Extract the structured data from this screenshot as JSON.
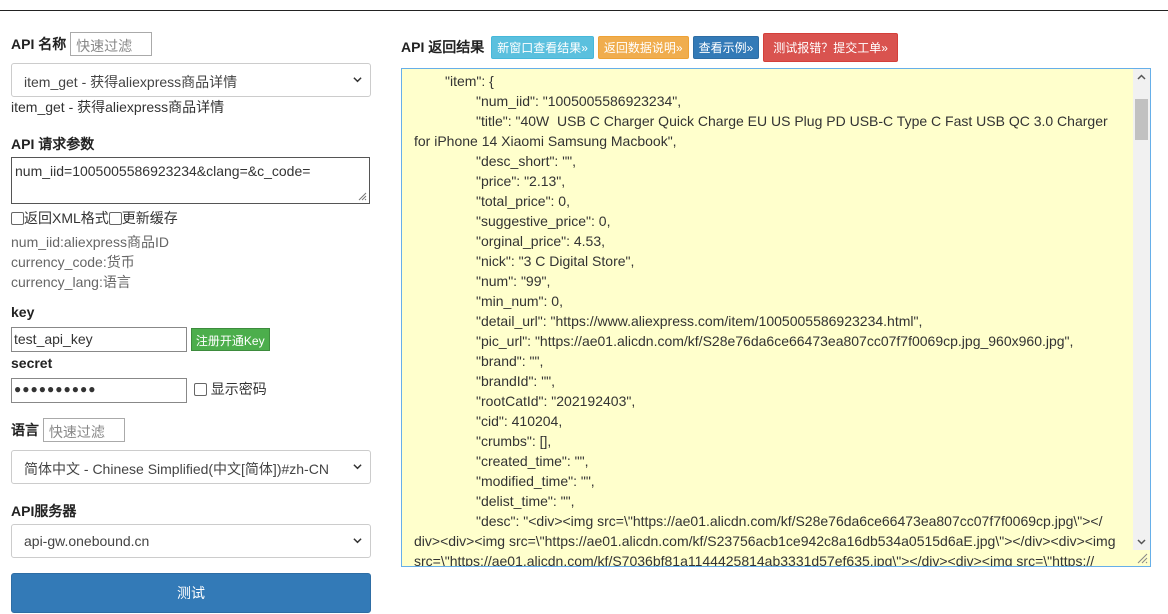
{
  "api_name": {
    "label": "API 名称",
    "filter_placeholder": "快速过滤",
    "selected": "item_get - 获得aliexpress商品详情",
    "caption": "item_get - 获得aliexpress商品详情"
  },
  "params": {
    "label": "API 请求参数",
    "value": "num_iid=1005005586923234&clang=&c_code=",
    "return_xml": "返回XML格式",
    "refresh_cache": "更新缓存",
    "notes": [
      "num_iid:aliexpress商品ID",
      "currency_code:货币",
      "currency_lang:语言"
    ]
  },
  "key": {
    "label": "key",
    "value": "test_api_key",
    "register_button": "注册开通Key"
  },
  "secret": {
    "label": "secret",
    "value": "●●●●●●●●●●",
    "show_password": "显示密码"
  },
  "language": {
    "label": "语言",
    "filter_placeholder": "快速过滤",
    "selected": "简体中文 - Chinese Simplified(中文[简体])#zh-CN"
  },
  "server": {
    "label": "API服务器",
    "selected": "api-gw.onebound.cn"
  },
  "test_button": "测试",
  "result": {
    "title": "API 返回结果",
    "buttons": {
      "new_window": "新窗口查看结果»",
      "return_doc": "返回数据说明»",
      "view_example": "查看示例»",
      "report_bug": "测试报错？提交工单»"
    },
    "lines": [
      "\"item\": {",
      "\"num_iid\": \"1005005586923234\",",
      "\"title\": \"40W  USB C Charger Quick Charge EU US Plug PD USB-C Type C Fast USB QC 3.0 Charger",
      "for iPhone 14 Xiaomi Samsung Macbook\",",
      "\"desc_short\": \"\",",
      "\"price\": \"2.13\",",
      "\"total_price\": 0,",
      "\"suggestive_price\": 0,",
      "\"orginal_price\": 4.53,",
      "\"nick\": \"3 C Digital Store\",",
      "\"num\": \"99\",",
      "\"min_num\": 0,",
      "\"detail_url\": \"https://www.aliexpress.com/item/1005005586923234.html\",",
      "\"pic_url\": \"https://ae01.alicdn.com/kf/S28e76da6ce66473ea807cc07f7f0069cp.jpg_960x960.jpg\",",
      "\"brand\": \"\",",
      "\"brandId\": \"\",",
      "\"rootCatId\": \"202192403\",",
      "\"cid\": 410204,",
      "\"crumbs\": [],",
      "\"created_time\": \"\",",
      "\"modified_time\": \"\",",
      "\"delist_time\": \"\",",
      "\"desc\": \"<div><img src=\\\"https://ae01.alicdn.com/kf/S28e76da6ce66473ea807cc07f7f0069cp.jpg\\\"></",
      "div><div><img src=\\\"https://ae01.alicdn.com/kf/S23756acb1ce942c8a16db534a0515d6aE.jpg\\\"></div><div><img",
      "src=\\\"https://ae01.alicdn.com/kf/S7036bf81a1144425814ab3331d57ef635.jpg\\\"></div><div><img src=\\\"https://"
    ]
  }
}
